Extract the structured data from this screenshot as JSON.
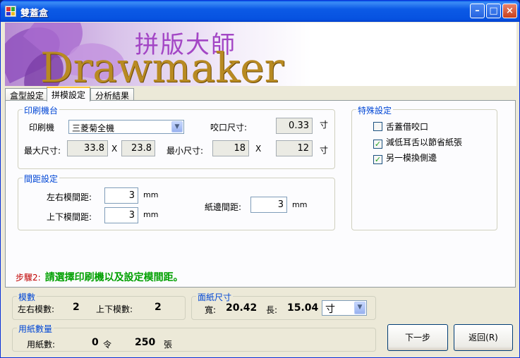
{
  "window": {
    "title": "雙蓋盒"
  },
  "banner": {
    "title_cn": "拼版大師",
    "title_en": "Drawmaker"
  },
  "tabs": [
    "盒型設定",
    "拼模設定",
    "分析結果"
  ],
  "printer": {
    "legend": "印刷機台",
    "machine_label": "印刷機",
    "machine_value": "三菱菊全機",
    "bite_label": "咬口尺寸:",
    "bite_value": "0.33",
    "bite_unit": "寸",
    "max_label": "最大尺寸:",
    "max_w": "33.8",
    "max_x": "X",
    "max_h": "23.8",
    "min_label": "最小尺寸:",
    "min_w": "18",
    "min_x": "X",
    "min_h": "12",
    "min_unit": "寸"
  },
  "spacing": {
    "legend": "間距設定",
    "lr_label": "左右模間距:",
    "lr_value": "3",
    "lr_unit": "mm",
    "tb_label": "上下模間距:",
    "tb_value": "3",
    "tb_unit": "mm",
    "edge_label": "紙邊間距:",
    "edge_value": "3",
    "edge_unit": "mm"
  },
  "special": {
    "legend": "特殊設定",
    "options": [
      {
        "label": "舌蓋借咬口",
        "checked": false
      },
      {
        "label": "減低耳舌以節省紙張",
        "checked": true
      },
      {
        "label": "另一模換側邊",
        "checked": true
      }
    ]
  },
  "step": {
    "number": "步驟2:",
    "message": "請選擇印刷機以及設定模間距。"
  },
  "molds": {
    "legend": "模數",
    "lr_label": "左右模數:",
    "lr_value": "2",
    "tb_label": "上下模數:",
    "tb_value": "2"
  },
  "paper_size": {
    "legend": "面紙尺寸",
    "width_label": "寬:",
    "width_value": "20.42",
    "length_label": "長:",
    "length_value": "15.04",
    "unit_value": "寸"
  },
  "paper_qty": {
    "legend": "用紙數量",
    "label": "用紙數:",
    "ream_value": "0",
    "ream_unit": "令",
    "sheet_value": "250",
    "sheet_unit": "張"
  },
  "buttons": {
    "next": "下一步",
    "back": "返回(R)"
  },
  "colors": {
    "title_bar": "#0a5ce8",
    "legend": "#0046d5",
    "step_number": "#c00000",
    "step_message": "#00a000"
  }
}
